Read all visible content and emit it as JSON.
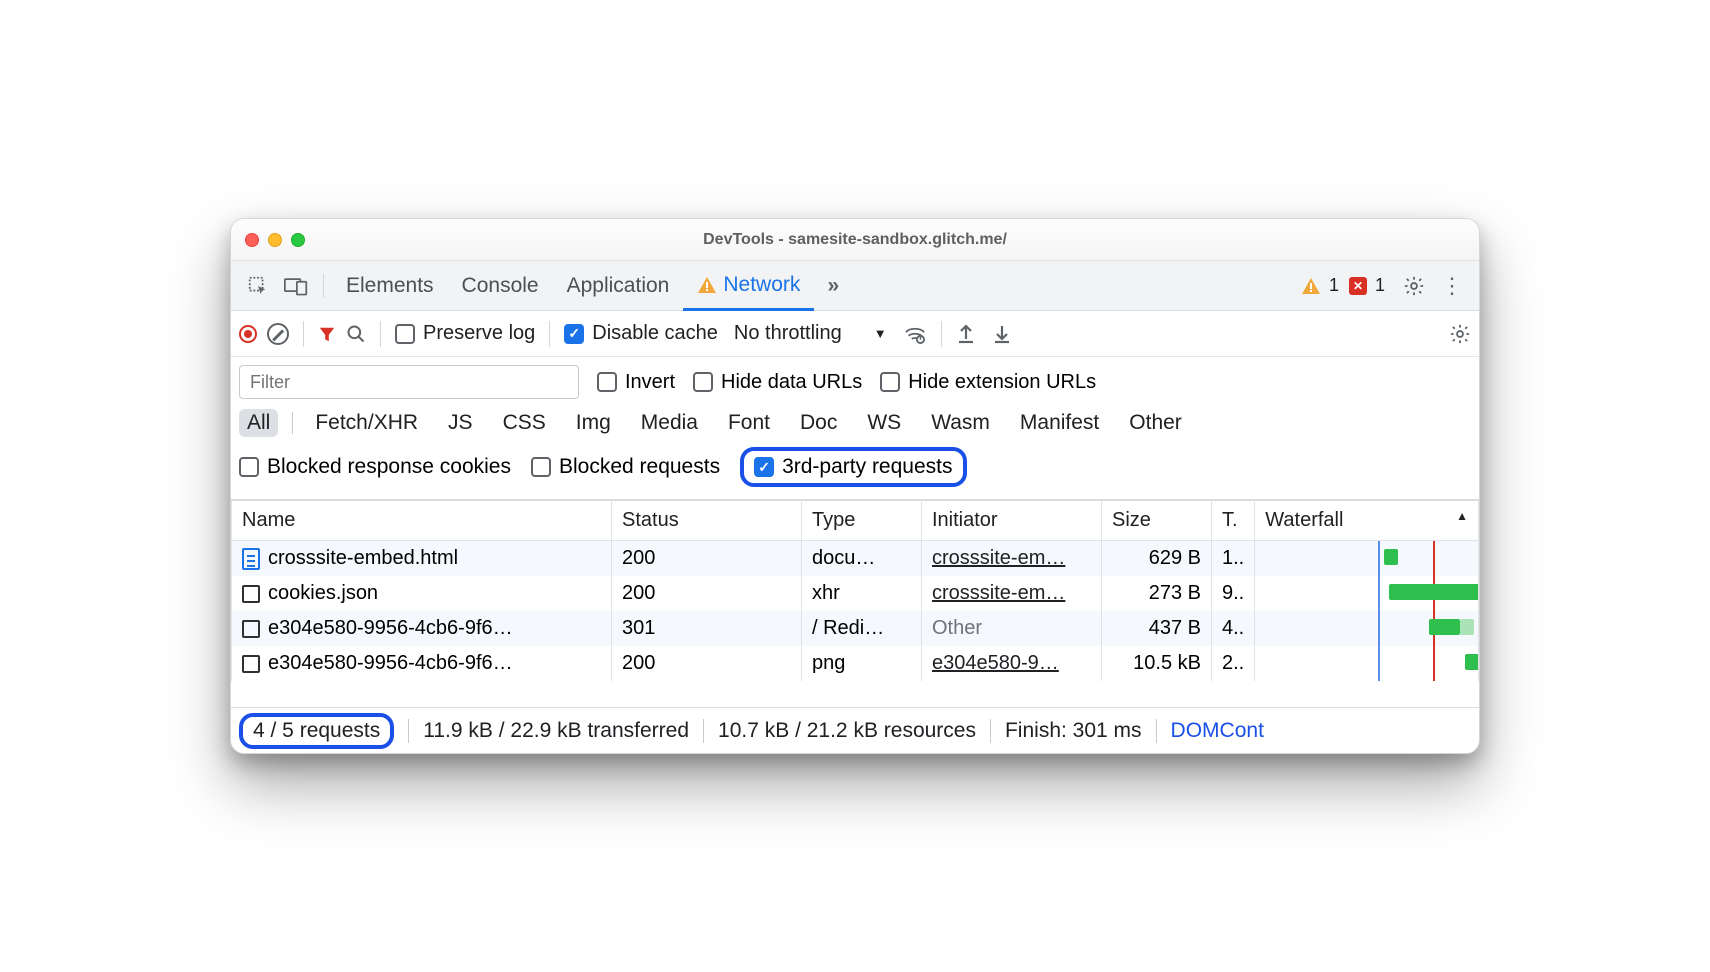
{
  "window": {
    "title": "DevTools - samesite-sandbox.glitch.me/"
  },
  "tabs": {
    "items": [
      "Elements",
      "Console",
      "Application",
      "Network"
    ],
    "active": "Network",
    "warn_count": "1",
    "err_count": "1"
  },
  "toolbar": {
    "preserve_log": "Preserve log",
    "disable_cache": "Disable cache",
    "throttling": "No throttling"
  },
  "filter": {
    "placeholder": "Filter",
    "invert": "Invert",
    "hide_data_urls": "Hide data URLs",
    "hide_ext_urls": "Hide extension URLs"
  },
  "types": [
    "All",
    "Fetch/XHR",
    "JS",
    "CSS",
    "Img",
    "Media",
    "Font",
    "Doc",
    "WS",
    "Wasm",
    "Manifest",
    "Other"
  ],
  "blocked": {
    "cookies": "Blocked response cookies",
    "requests": "Blocked requests",
    "third_party": "3rd-party requests"
  },
  "columns": {
    "name": "Name",
    "status": "Status",
    "type": "Type",
    "initiator": "Initiator",
    "size": "Size",
    "time": "T.",
    "waterfall": "Waterfall"
  },
  "rows": [
    {
      "icon": "doc",
      "name": "crosssite-embed.html",
      "status": "200",
      "type": "docu…",
      "initiator": "crosssite-em…",
      "initiator_link": true,
      "size": "629 B",
      "time": "1.."
    },
    {
      "icon": "box",
      "name": "cookies.json",
      "status": "200",
      "type": "xhr",
      "initiator": "crosssite-em…",
      "initiator_link": true,
      "size": "273 B",
      "time": "9.."
    },
    {
      "icon": "box",
      "name": "e304e580-9956-4cb6-9f6…",
      "status": "301",
      "type": "/ Redi…",
      "initiator": "Other",
      "initiator_link": false,
      "size": "437 B",
      "time": "4.."
    },
    {
      "icon": "box",
      "name": "e304e580-9956-4cb6-9f6…",
      "status": "200",
      "type": "png",
      "initiator": "e304e580-9…",
      "initiator_link": true,
      "size": "10.5 kB",
      "time": "2.."
    }
  ],
  "status": {
    "requests": "4 / 5 requests",
    "transferred": "11.9 kB / 22.9 kB transferred",
    "resources": "10.7 kB / 21.2 kB resources",
    "finish": "Finish: 301 ms",
    "dom": "DOMCont"
  }
}
